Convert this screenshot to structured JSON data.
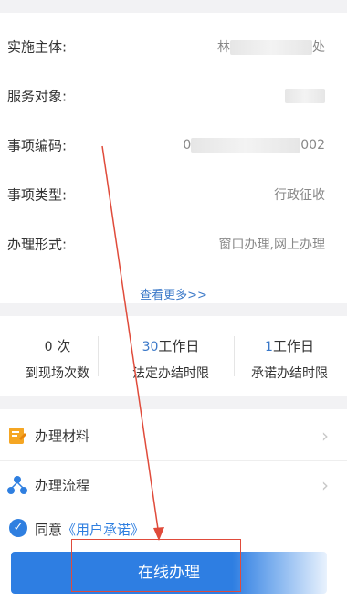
{
  "details": [
    {
      "label": "实施主体:",
      "value_prefix": "林",
      "value_suffix": "处"
    },
    {
      "label": "服务对象:",
      "value_prefix": "",
      "value_suffix": ""
    },
    {
      "label": "事项编码:",
      "value_prefix": "0",
      "value_suffix": "002"
    },
    {
      "label": "事项类型:",
      "value_prefix": "行政征收",
      "value_suffix": ""
    },
    {
      "label": "办理形式:",
      "value_prefix": "窗口办理,网上办理",
      "value_suffix": ""
    }
  ],
  "see_more": "查看更多>>",
  "stats": [
    {
      "num": "0",
      "unit": "次",
      "label": "到现场次数"
    },
    {
      "num": "30",
      "unit": "工作日",
      "label": "法定办结时限"
    },
    {
      "num": "1",
      "unit": "工作日",
      "label": "承诺办结时限"
    }
  ],
  "links": [
    {
      "label": "办理材料",
      "icon": "document-icon"
    },
    {
      "label": "办理流程",
      "icon": "flow-icon"
    }
  ],
  "agree": {
    "prefix": "同意",
    "link": "《用户承诺》"
  },
  "online_button": "在线办理",
  "colors": {
    "accent": "#2f7fe0",
    "annotation": "#e04b3b"
  }
}
